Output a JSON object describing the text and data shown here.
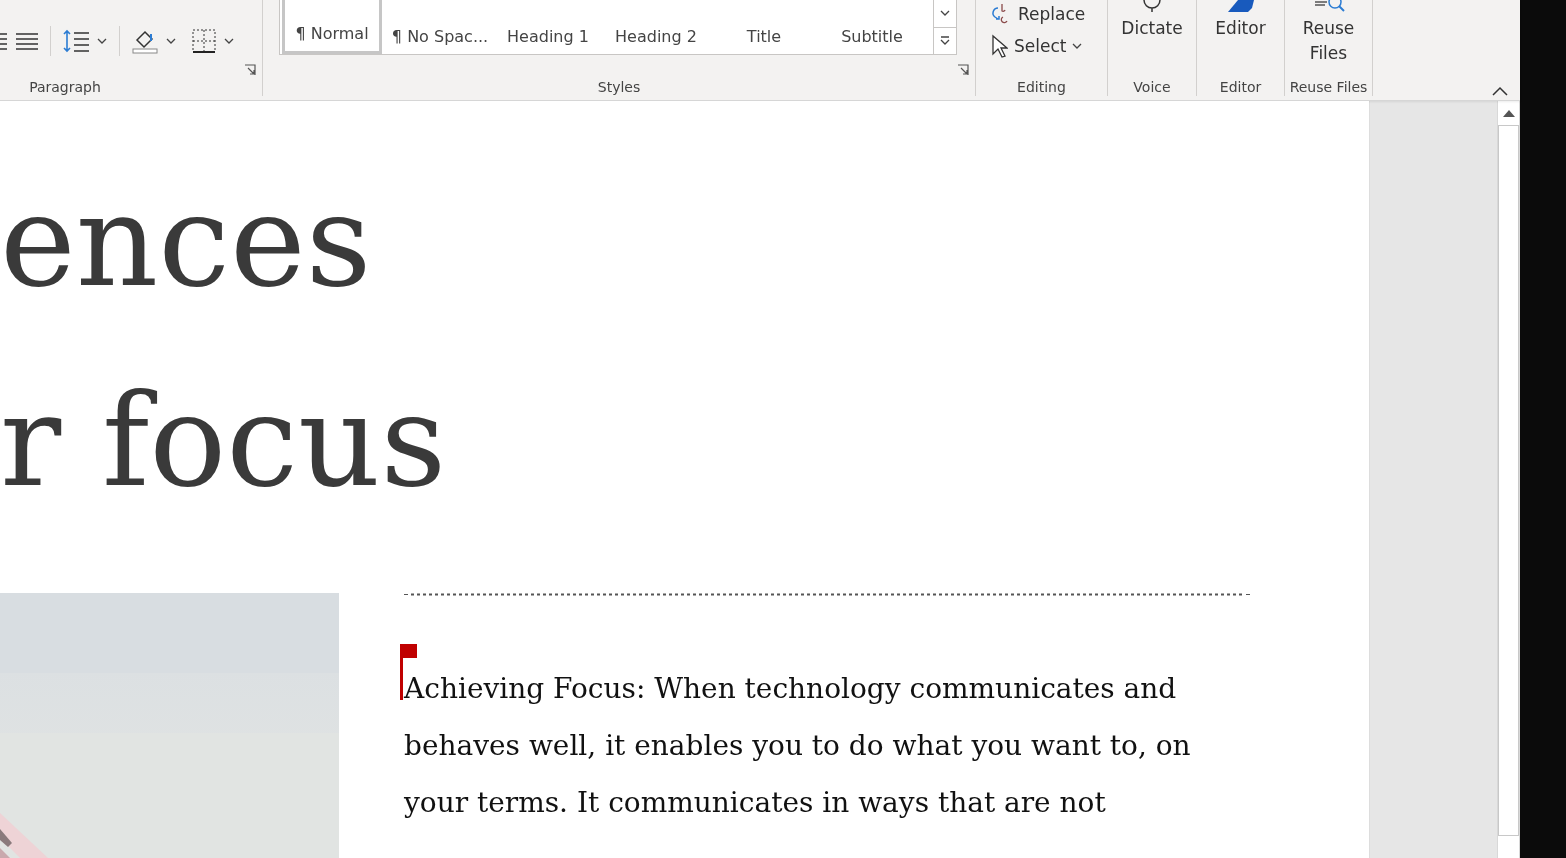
{
  "ribbon": {
    "paragraph_group": {
      "label": "Paragraph"
    },
    "styles_group": {
      "label": "Styles",
      "styles": [
        {
          "label": "¶ Normal",
          "selected": true
        },
        {
          "label": "¶ No Spac...",
          "selected": false
        },
        {
          "label": "Heading 1",
          "selected": false
        },
        {
          "label": "Heading 2",
          "selected": false
        },
        {
          "label": "Title",
          "selected": false
        },
        {
          "label": "Subtitle",
          "selected": false
        }
      ]
    },
    "editing_group": {
      "label": "Editing",
      "commands": [
        {
          "kind": "replace",
          "label": "Replace"
        },
        {
          "kind": "select",
          "label": "Select"
        }
      ]
    },
    "voice_group": {
      "label": "Voice",
      "button": "Dictate"
    },
    "editor_group": {
      "label": "Editor",
      "button": "Editor"
    },
    "reuse_group": {
      "label": "Reuse Files",
      "button": "Reuse Files"
    }
  },
  "document": {
    "headline_lines": [
      "ences",
      "r focus"
    ],
    "paragraph_lines": [
      "Achieving Focus: When technology communicates and",
      "behaves well, it enables you to do what you want to, on",
      "your terms. It communicates in ways that are not"
    ],
    "image": {
      "kind": "picture"
    }
  }
}
